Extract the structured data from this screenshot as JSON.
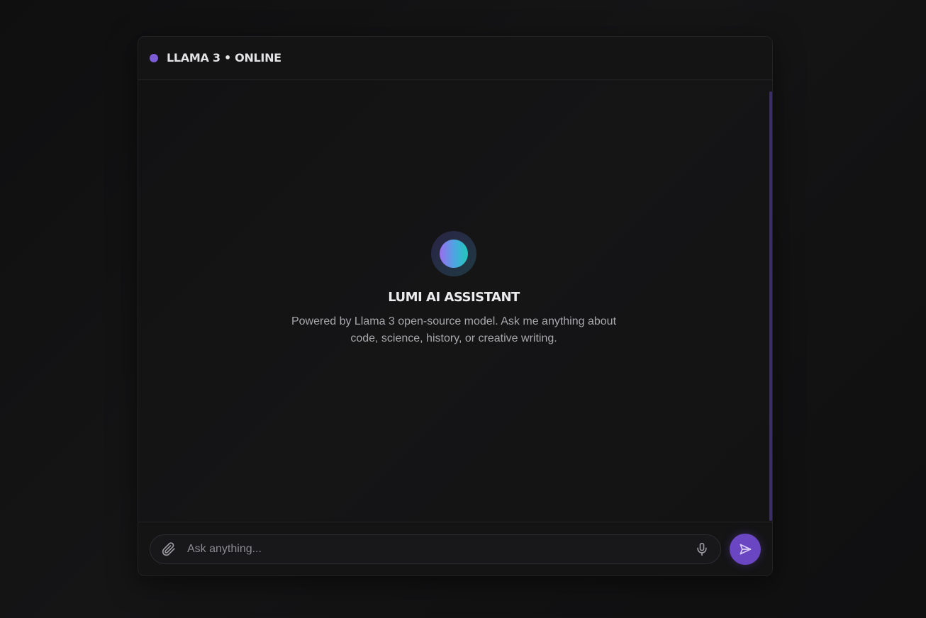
{
  "header": {
    "status_color": "#7c5cd6",
    "title": "LLAMA 3 • ONLINE"
  },
  "empty_state": {
    "title": "LUMI AI ASSISTANT",
    "description": "Powered by Llama 3 open-source model. Ask me anything about code, science, history, or creative writing."
  },
  "composer": {
    "placeholder": "Ask anything...",
    "value": "",
    "attach_icon": "paperclip-icon",
    "mic_icon": "microphone-icon",
    "send_icon": "send-icon"
  },
  "colors": {
    "accent": "#6a46c2",
    "orb_gradient": [
      "#9b6cf2",
      "#4aa8e0",
      "#1fc8b8"
    ]
  }
}
